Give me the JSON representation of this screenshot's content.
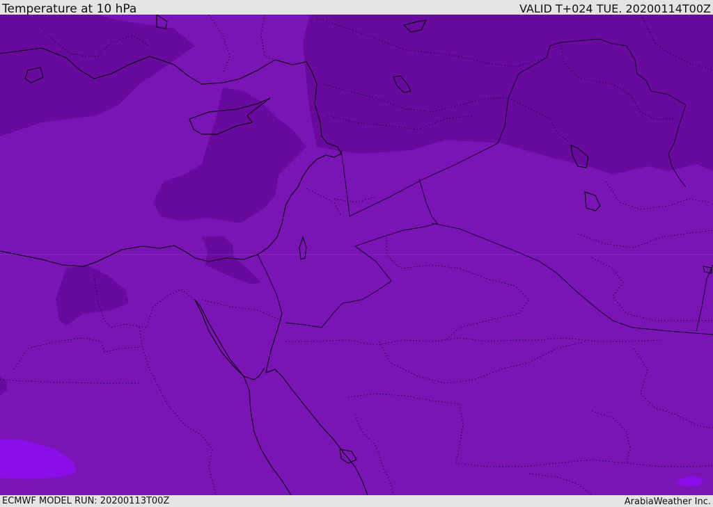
{
  "header": {
    "title": "Temperature at 10 hPa",
    "valid": "VALID T+024 TUE. 20200114T00Z"
  },
  "footer": {
    "model_run": "ECMWF MODEL RUN: 20200113T00Z",
    "credit": "ArabiaWeather Inc."
  },
  "map": {
    "fill_colors": {
      "base": "#7a14b4",
      "darker": "#680a9e",
      "lighter": "#8a0ee8",
      "land": "#000000",
      "border": "#1a0030"
    }
  }
}
